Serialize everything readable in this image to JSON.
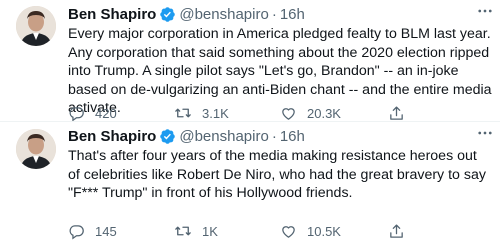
{
  "tweets": [
    {
      "name": "Ben Shapiro",
      "handle": "@benshapiro",
      "separator": "·",
      "time": "16h",
      "text": "Every major corporation in America pledged fealty to BLM last year. Any corporation that said something about the 2020 election ripped into Trump. A single pilot says \"Let's go, Brandon\" -- an in-joke based on de-vulgarizing an anti-Biden chant -- and the entire media activate.",
      "replies": "420",
      "retweets": "3.1K",
      "likes": "20.3K"
    },
    {
      "name": "Ben Shapiro",
      "handle": "@benshapiro",
      "separator": "·",
      "time": "16h",
      "text": "That's after four years of the media making resistance heroes out of celebrities like Robert De Niro, who had the great bravery to say \"F*** Trump\" in front of his Hollywood friends.",
      "replies": "145",
      "retweets": "1K",
      "likes": "10.5K"
    }
  ],
  "icons": {
    "verified": "verified-badge-icon",
    "reply": "reply-icon",
    "retweet": "retweet-icon",
    "like": "heart-icon",
    "share": "share-icon",
    "more": "more-icon"
  },
  "colors": {
    "verified": "#1d9bf0",
    "muted": "#536471",
    "text": "#0f1419"
  }
}
